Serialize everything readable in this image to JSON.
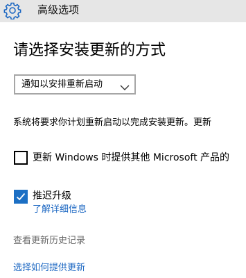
{
  "window": {
    "title": "高级选项",
    "icon": "gear-icon"
  },
  "page": {
    "heading": "请选择安装更新的方式"
  },
  "install_mode": {
    "selected": "通知以安排重新启动",
    "icon": "chevron-down-icon"
  },
  "description": "系统将要求你计划重新启动以完成安装更新。更新",
  "options": {
    "other_products": {
      "label": "更新 Windows 时提供其他 Microsoft 产品的",
      "checked": false
    },
    "defer_upgrades": {
      "label": "推迟升级",
      "checked": true,
      "link": "了解详细信息"
    }
  },
  "links": {
    "history": "查看更新历史记录",
    "delivery": "选择如何提供更新"
  },
  "colors": {
    "accent": "#1c6fc4",
    "link": "#1a66c2",
    "titlebar_bg": "#e6e6e6",
    "muted_text": "#6b6b6b"
  }
}
